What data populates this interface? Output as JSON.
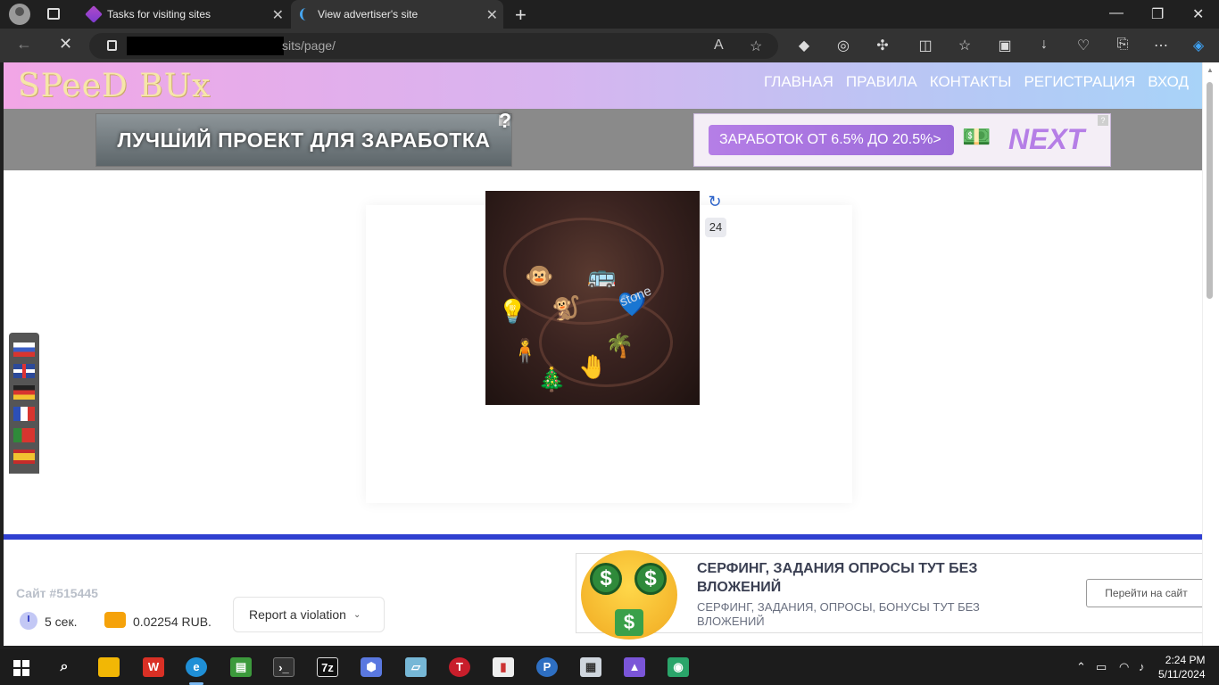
{
  "browser": {
    "tabs": [
      {
        "title": "Tasks for visiting sites"
      },
      {
        "title": "View advertiser's site"
      }
    ],
    "url_visible": "sits/page/"
  },
  "site": {
    "logo": "SPeeD BUx",
    "menu": [
      "ГЛАВНАЯ",
      "ПРАВИЛА",
      "КОНТАКТЫ",
      "РЕГИСТРАЦИЯ",
      "ВХОД"
    ],
    "banner_left": "ЛУЧШИЙ ПРОЕКТ ДЛЯ ЗАРАБОТКА",
    "banner_right_text": "ЗАРАБОТОК ОТ 6.5% ДО 20.5%>",
    "banner_right_brand": "NEXT",
    "banner_help": "?",
    "captcha_watermark": "stone",
    "counter": "24"
  },
  "footer": {
    "site_id": "Сайт #515445",
    "seconds": "5 сек.",
    "reward": "0.02254 RUB.",
    "report_label": "Report a violation"
  },
  "ad": {
    "title": "СЕРФИНГ, ЗАДАНИЯ ОПРОСЫ ТУТ БЕЗ ВЛОЖЕНИЙ",
    "subtitle": "СЕРФИНГ, ЗАДАНИЯ, ОПРОСЫ, БОНУСЫ ТУТ БЕЗ ВЛОЖЕНИЙ",
    "button": "Перейти на сайт",
    "emoji_symbol": "$"
  },
  "taskbar": {
    "time": "2:24 PM",
    "date": "5/11/2024"
  }
}
